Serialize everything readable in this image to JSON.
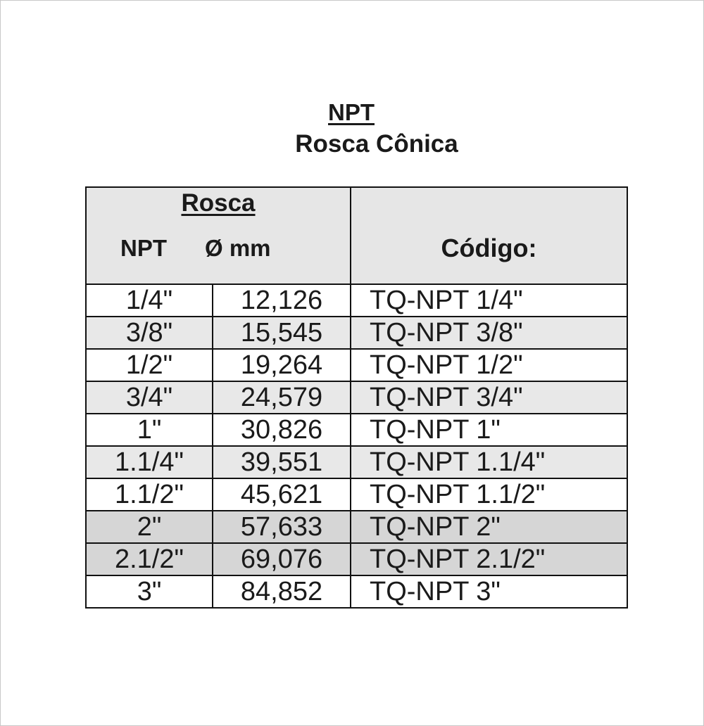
{
  "title": {
    "line1": "NPT",
    "line2": "Rosca Cônica"
  },
  "table": {
    "header": {
      "group_label": "Rosca",
      "col_npt": "NPT",
      "col_mm": "Ø mm",
      "col_code": "Código:"
    },
    "rows": [
      {
        "npt": "1/4\"",
        "mm": "12,126",
        "code": "TQ-NPT 1/4\"",
        "shade": "white"
      },
      {
        "npt": "3/8\"",
        "mm": "15,545",
        "code": "TQ-NPT 3/8\"",
        "shade": "light"
      },
      {
        "npt": "1/2\"",
        "mm": "19,264",
        "code": "TQ-NPT 1/2\"",
        "shade": "white"
      },
      {
        "npt": "3/4\"",
        "mm": "24,579",
        "code": "TQ-NPT 3/4\"",
        "shade": "light"
      },
      {
        "npt": "1\"",
        "mm": "30,826",
        "code": "TQ-NPT 1\"",
        "shade": "white"
      },
      {
        "npt": "1.1/4\"",
        "mm": "39,551",
        "code": "TQ-NPT 1.1/4\"",
        "shade": "light"
      },
      {
        "npt": "1.1/2\"",
        "mm": "45,621",
        "code": "TQ-NPT 1.1/2\"",
        "shade": "white"
      },
      {
        "npt": "2\"",
        "mm": "57,633",
        "code": "TQ-NPT 2\"",
        "shade": "dark"
      },
      {
        "npt": "2.1/2\"",
        "mm": "69,076",
        "code": "TQ-NPT 2.1/2\"",
        "shade": "dark"
      },
      {
        "npt": "3\"",
        "mm": "84,852",
        "code": "TQ-NPT 3\"",
        "shade": "white"
      }
    ]
  },
  "colors": {
    "header_bg": "#e6e6e6",
    "row_light": "#e8e8e8",
    "row_dark": "#d6d6d6",
    "border": "#111111",
    "text": "#1a1a1a"
  }
}
